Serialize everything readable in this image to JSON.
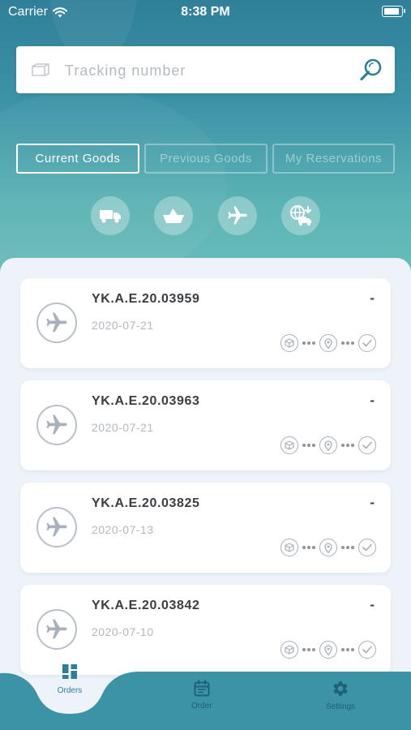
{
  "status_bar": {
    "carrier": "Carrier",
    "time": "8:38 PM"
  },
  "search": {
    "placeholder": "Tracking number"
  },
  "tabs": [
    {
      "label": "Current Goods",
      "active": true
    },
    {
      "label": "Previous Goods",
      "active": false
    },
    {
      "label": "My Reservations",
      "active": false
    }
  ],
  "transport_modes": [
    {
      "icon": "truck-icon"
    },
    {
      "icon": "ship-icon"
    },
    {
      "icon": "airplane-icon"
    },
    {
      "icon": "delivery-globe-icon"
    }
  ],
  "shipments": [
    {
      "code": "YK.A.E.20.03959",
      "date": "2020-07-21",
      "status": "-",
      "mode_icon": "airplane-icon"
    },
    {
      "code": "YK.A.E.20.03963",
      "date": "2020-07-21",
      "status": "-",
      "mode_icon": "airplane-icon"
    },
    {
      "code": "YK.A.E.20.03825",
      "date": "2020-07-13",
      "status": "-",
      "mode_icon": "airplane-icon"
    },
    {
      "code": "YK.A.E.20.03842",
      "date": "2020-07-10",
      "status": "-",
      "mode_icon": "airplane-icon"
    }
  ],
  "progress_steps": [
    "package-icon",
    "location-pin-icon",
    "check-icon"
  ],
  "bottom_nav": [
    {
      "label": "Orders",
      "icon": "grid-icon",
      "active": true
    },
    {
      "label": "Order",
      "icon": "calendar-icon",
      "active": false
    },
    {
      "label": "Settings",
      "icon": "gear-icon",
      "active": false
    }
  ],
  "colors": {
    "primary": "#2e7f95",
    "hero_top": "#2f7f99",
    "hero_bottom": "#6cc0bb",
    "background": "#eef2f9",
    "nav_bar": "#3d93a6"
  }
}
